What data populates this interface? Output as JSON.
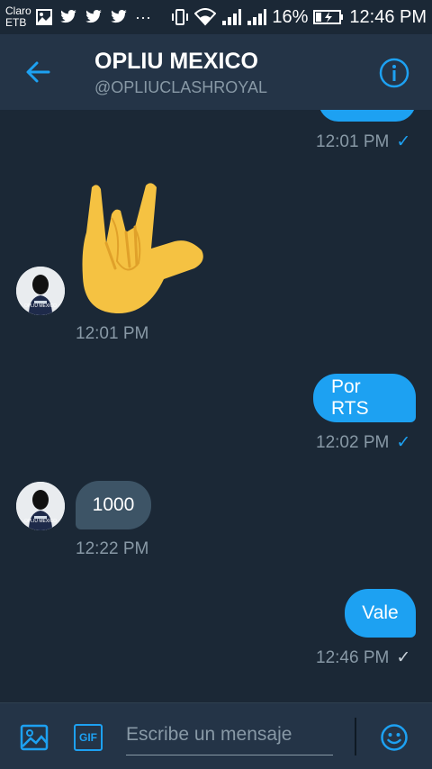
{
  "status_bar": {
    "carrier_line1": "Claro",
    "carrier_line2": "ETB",
    "notif_icons": [
      "image-icon",
      "twitter-icon",
      "twitter-icon",
      "twitter-icon",
      "more-icon"
    ],
    "battery": "16%",
    "time": "12:46 PM"
  },
  "header": {
    "title": "OPLIU MEXICO",
    "handle": "@OPLIUCLASHROYAL"
  },
  "messages": [
    {
      "direction": "out",
      "type": "text-partial",
      "time": "12:01 PM",
      "status": "sent-blue"
    },
    {
      "direction": "in",
      "type": "emoji",
      "emoji": "🤟",
      "time": "12:01 PM"
    },
    {
      "direction": "out",
      "type": "text",
      "text": "Por RTS",
      "time": "12:02 PM",
      "status": "sent-blue"
    },
    {
      "direction": "in",
      "type": "text",
      "text": "1000",
      "time": "12:22 PM"
    },
    {
      "direction": "out",
      "type": "text",
      "text": "Vale",
      "time": "12:46 PM",
      "status": "sent"
    }
  ],
  "avatar_text": "OPLIU MEXICO",
  "composer": {
    "placeholder": "Escribe un mensaje",
    "gif_label": "GIF"
  },
  "colors": {
    "background": "#1b2836",
    "header": "#243447",
    "accent": "#1da1f2",
    "incoming_bubble": "#3d5466",
    "muted": "#8899a6"
  }
}
